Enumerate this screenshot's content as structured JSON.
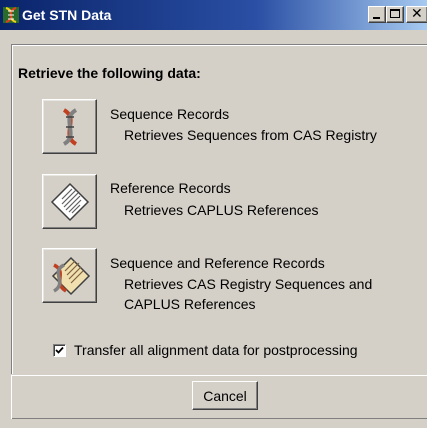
{
  "window": {
    "title": "Get STN Data",
    "icon": "dna-helix-icon",
    "controls": [
      "minimize",
      "maximize",
      "close"
    ]
  },
  "heading": "Retrieve the following data:",
  "options": [
    {
      "icon": "dna-helix-icon",
      "title": "Sequence Records",
      "description": [
        "Retrieves Sequences from CAS Registry"
      ]
    },
    {
      "icon": "document-icon",
      "title": "Reference Records",
      "description": [
        "Retrieves CAPLUS References"
      ]
    },
    {
      "icon": "dna-document-icon",
      "title": "Sequence and Reference Records",
      "description": [
        "Retrieves CAS Registry Sequences and",
        "CAPLUS References"
      ]
    }
  ],
  "transfer_option": {
    "label": "Transfer all alignment data for postprocessing",
    "checked": true
  },
  "cancel_label": "Cancel",
  "colors": {
    "titlebar_start": "#0a246a",
    "titlebar_end": "#a6caf0",
    "face": "#d4d0c8"
  }
}
